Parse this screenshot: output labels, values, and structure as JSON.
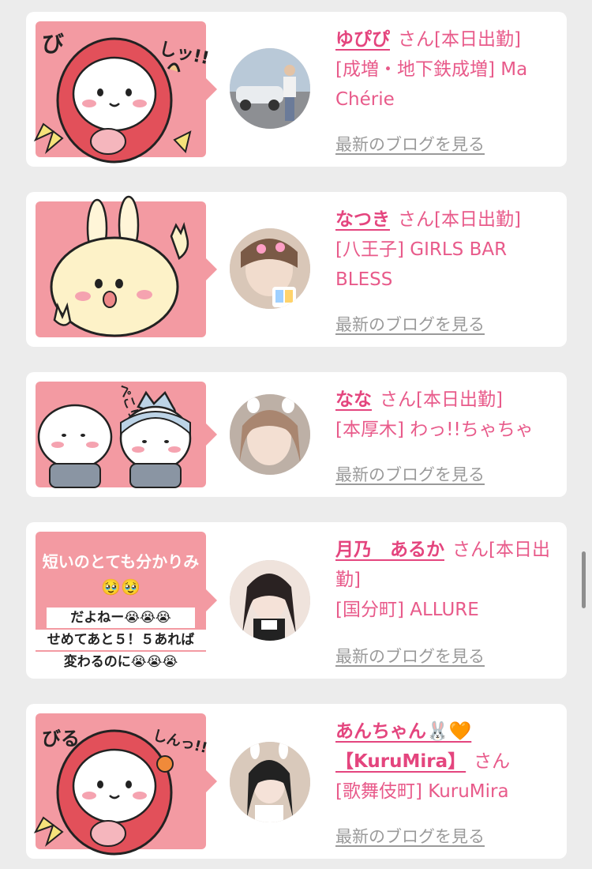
{
  "posts": [
    {
      "name": "ゆぴぴ",
      "suffix": "さん",
      "status": "[本日出勤]",
      "location": "[成増・地下鉄成増] Ma Chérie",
      "blog_link": "最新のブログを見る",
      "bubble_text": "",
      "sticker": "red-hood-character-sticker",
      "sticker_caption_left": "び",
      "sticker_caption_right": "しッ!!"
    },
    {
      "name": "なつき",
      "suffix": "さん",
      "status": "[本日出勤]",
      "location": "[八王子] GIRLS BAR BLESS",
      "blog_link": "最新のブログを見る",
      "bubble_text": "",
      "sticker": "bunny-character-sticker"
    },
    {
      "name": "なな",
      "suffix": "さん",
      "status": "[本日出勤]",
      "location": "[本厚木] わっ!!ちゃちゃ",
      "blog_link": "最新のブログを見る",
      "bubble_text": "",
      "sticker": "bowing-pair-sticker",
      "sticker_caption": "ぺこり"
    },
    {
      "name": "月乃　あるか",
      "suffix": "さん",
      "status": "[本日出勤]",
      "location": "[国分町] ALLURE",
      "blog_link": "最新のブログを見る",
      "bubble_text": "短いのとても分かりみ🥹🥹",
      "reply_text_1": "だよねー😭😭😭",
      "reply_text_2": "せめてあと５！５あれば",
      "reply_text_3": "変わるのに😭😭😭"
    },
    {
      "name": "あんちゃん🐰🧡【KuruMira】",
      "suffix": "さん",
      "status": "",
      "location": "[歌舞伎町] KuruMira",
      "blog_link": "最新のブログを見る",
      "bubble_text": "",
      "sticker": "red-hood-character-sticker",
      "sticker_caption_left": "びる",
      "sticker_caption_right": "しんっ!!"
    }
  ],
  "colors": {
    "accent": "#e4457e",
    "bubble": "#f39aa2",
    "link_gray": "#9a9a9a",
    "background": "#ececec"
  }
}
